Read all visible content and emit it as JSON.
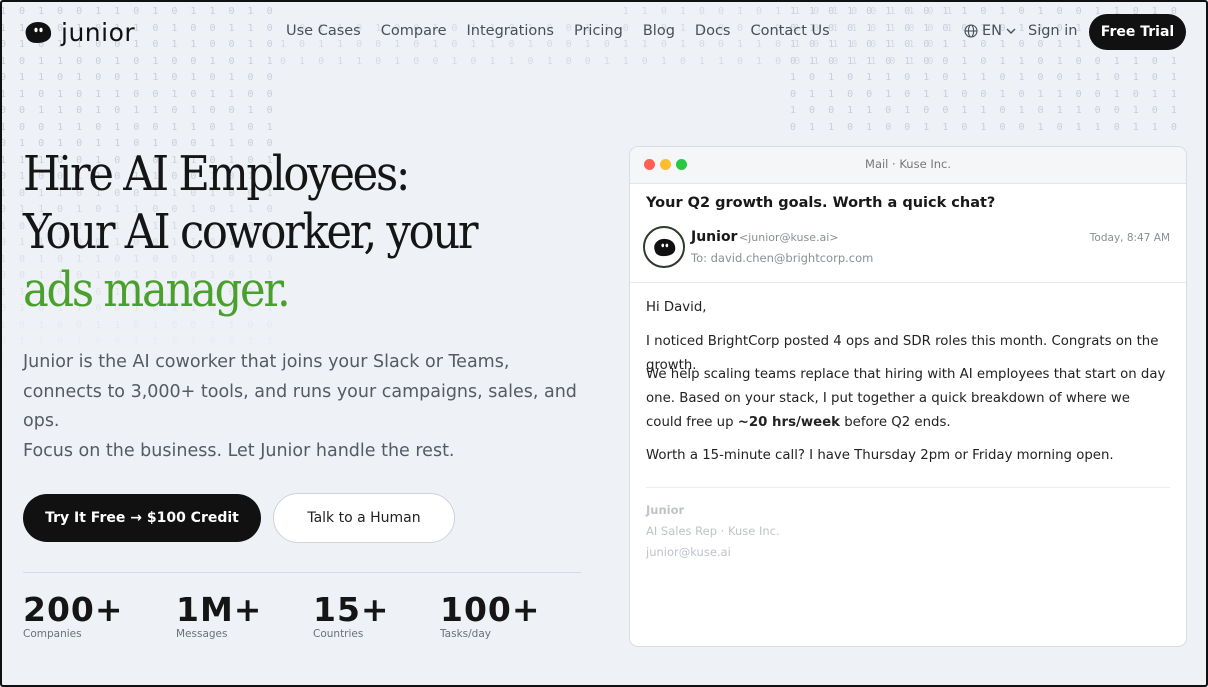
{
  "brand": {
    "name": "junior"
  },
  "nav": {
    "items": [
      "Use Cases",
      "Compare",
      "Integrations",
      "Pricing",
      "Blog",
      "Docs",
      "Contact Us"
    ],
    "language": "EN",
    "signin": "Sign in",
    "cta": "Free Trial"
  },
  "hero": {
    "title_line1": "Hire AI Employees:",
    "title_line2": "Your AI coworker, your",
    "title_line3": "ads manager.",
    "desc_line1": "Junior is the AI coworker that joins your Slack or Teams,",
    "desc_line2": "connects to 3,000+ tools, and runs your campaigns, sales, and",
    "desc_line3": "ops.",
    "desc_line4": "Focus on the business. Let Junior handle the rest.",
    "primary_button": "Try It Free → $100 Credit",
    "secondary_button": "Talk to a Human"
  },
  "stats": [
    {
      "value": "200+",
      "label": "Companies"
    },
    {
      "value": "1M+",
      "label": "Messages"
    },
    {
      "value": "15+",
      "label": "Countries"
    },
    {
      "value": "100+",
      "label": "Tasks/day"
    }
  ],
  "mail": {
    "window_title": "Mail · Kuse Inc.",
    "subject": "Your Q2 growth goals. Worth a quick chat?",
    "from_name": "Junior",
    "from_address": "<junior@kuse.ai>",
    "to": "To: david.chen@brightcorp.com",
    "date": "Today, 8:47 AM",
    "greeting": "Hi David,",
    "p1": "I noticed BrightCorp posted 4 ops and SDR roles this month. Congrats on the growth.",
    "p2_a": "We help scaling teams replace that hiring with AI employees that start on day one. Based on your stack, I put together a quick breakdown of where we could free up ",
    "p2_bold": "~20 hrs/week",
    "p2_b": " before Q2 ends.",
    "p3": "Worth a 15-minute call? I have Thursday 2pm or Friday morning open.",
    "sig_name": "Junior",
    "sig_role": "AI Sales Rep · Kuse Inc.",
    "sig_email": "junior@kuse.ai"
  },
  "colors": {
    "accent_green": "#4aa02c",
    "dark": "#111111",
    "dot_red": "#ff5f57",
    "dot_yellow": "#febc2e",
    "dot_green": "#28c840"
  },
  "icons": {
    "globe": "globe-icon",
    "chevron": "chevron-down-icon",
    "logo": "logo-blob-icon"
  }
}
